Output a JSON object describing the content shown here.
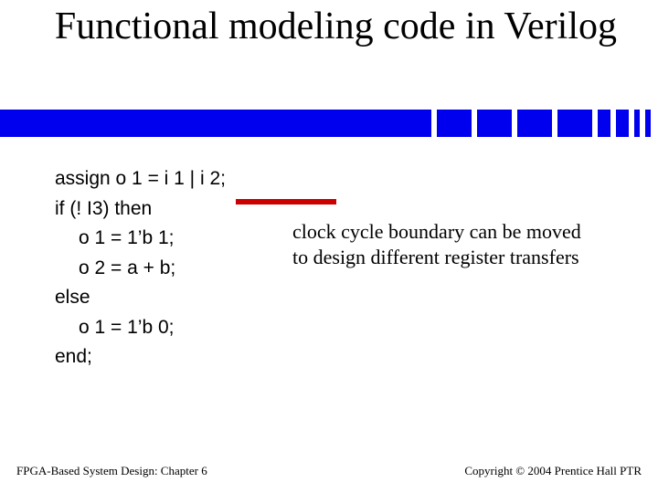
{
  "title": "Functional modeling code in Verilog",
  "code": {
    "l1": "assign o 1 = i 1 |  i 2;",
    "l2": "if (! I3) then",
    "l3": "o 1 = 1’b 1;",
    "l4": "o 2 = a + b;",
    "l5": "else",
    "l6": "o 1 = 1’b 0;",
    "l7": "end;"
  },
  "note": "clock cycle boundary can be moved to design different register transfers",
  "footer": {
    "left": "FPGA-Based System Design: Chapter 6",
    "right": "Copyright © 2004 Prentice Hall PTR"
  }
}
